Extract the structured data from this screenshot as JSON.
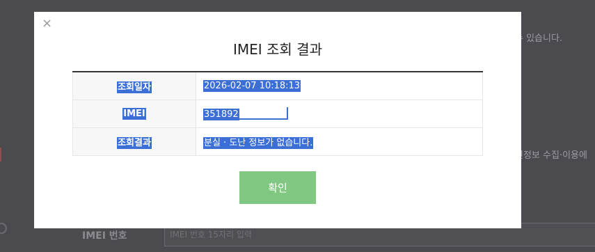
{
  "background": {
    "text_1": "수 있습니다.",
    "text_2": "인정보 수집·이용에",
    "imei_label": "IMEI 번호",
    "imei_placeholder": "IMEI 번호 15자리 입력"
  },
  "modal": {
    "close_symbol": "×",
    "title": "IMEI 조회 결과",
    "rows": [
      {
        "label": "조회일자",
        "value": "2026-02-07 10:18:13"
      },
      {
        "label": "IMEI",
        "value": "351892"
      },
      {
        "label": "조회결과",
        "value": "분실 · 도난 정보가 없습니다."
      }
    ],
    "confirm_label": "확인"
  },
  "colors": {
    "overlay": "#4a4a4f",
    "selection": "#3b6fd6",
    "confirm_button": "#80c882"
  }
}
